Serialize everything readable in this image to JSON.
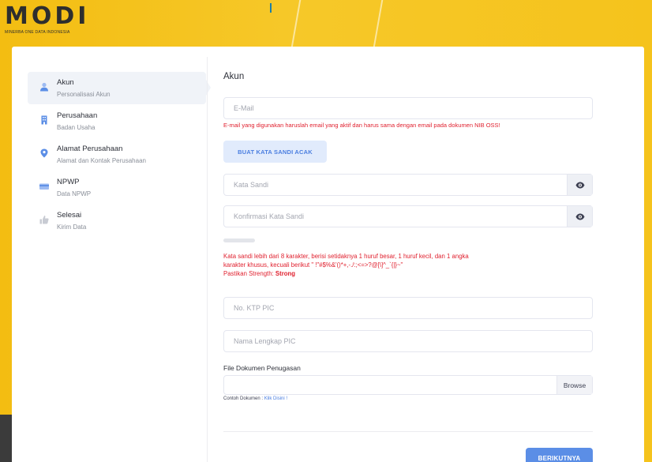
{
  "brand": {
    "logo_text": "MODI",
    "tagline": "MINERBA ONE DATA INDONESIA",
    "colors": {
      "primary": "#5b8ee6",
      "error": "#e0212f",
      "background": "#f4c21c"
    }
  },
  "sidebar": {
    "items": [
      {
        "title": "Akun",
        "subtitle": "Personalisasi Akun",
        "icon": "user-icon",
        "active": true
      },
      {
        "title": "Perusahaan",
        "subtitle": "Badan Usaha",
        "icon": "building-icon",
        "active": false
      },
      {
        "title": "Alamat Perusahaan",
        "subtitle": "Alamat dan Kontak Perusahaan",
        "icon": "location-pin-icon",
        "active": false
      },
      {
        "title": "NPWP",
        "subtitle": "Data NPWP",
        "icon": "credit-card-icon",
        "active": false
      },
      {
        "title": "Selesai",
        "subtitle": "Kirim Data",
        "icon": "thumbs-up-icon",
        "active": false
      }
    ]
  },
  "form": {
    "section_title": "Akun",
    "email": {
      "placeholder": "E-Mail",
      "value": "",
      "error": "E-mail yang digunakan haruslah email yang aktif dan harus sama dengan email pada dokumen NIB OSS!"
    },
    "generate_button": "BUAT KATA SANDI ACAK",
    "password": {
      "placeholder": "Kata Sandi",
      "value": "",
      "toggle_icon": "eye-icon"
    },
    "confirm_password": {
      "placeholder": "Konfirmasi Kata Sandi",
      "value": "",
      "toggle_icon": "eye-icon"
    },
    "password_rules": {
      "line1": "Kata sandi lebih dari 8 karakter, berisi setidaknya 1 huruf besar, 1 huruf kecil, dan 1 angka",
      "line2": "karakter khusus, kecuali berikut \" !\"#$%&'()*+,-./:;<=>?@[\\]^_`{|}~\"",
      "strength_label": "Pastikan Strength:",
      "strength_value": "Strong"
    },
    "ktp": {
      "placeholder": "No. KTP PIC",
      "value": ""
    },
    "full_name": {
      "placeholder": "Nama Lengkap PIC",
      "value": ""
    },
    "file": {
      "label": "File Dokumen Penugasan",
      "browse_label": "Browse",
      "sample_label": "Contoh Dokumen :",
      "sample_link": "Klik Disini !"
    },
    "next_button": "BERIKUTNYA"
  }
}
